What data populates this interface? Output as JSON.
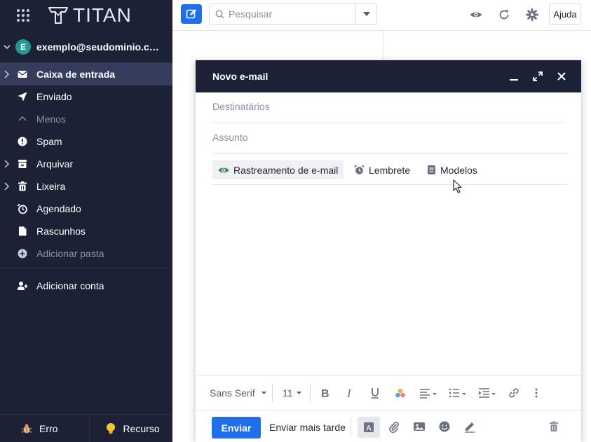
{
  "app": {
    "logo_text": "TITAN"
  },
  "account": {
    "avatar_letter": "E",
    "email": "exemplo@seudominio.co..."
  },
  "sidebar": {
    "items": [
      {
        "label": "Caixa de entrada",
        "icon": "inbox-icon",
        "active": true,
        "expandable": true
      },
      {
        "label": "Enviado",
        "icon": "send-icon",
        "active": false,
        "expandable": false
      },
      {
        "label": "Menos",
        "icon": "chevron-up-icon",
        "active": false,
        "expandable": false,
        "muted": true
      },
      {
        "label": "Spam",
        "icon": "spam-icon",
        "active": false,
        "expandable": false
      },
      {
        "label": "Arquivar",
        "icon": "archive-icon",
        "active": false,
        "expandable": true
      },
      {
        "label": "Lixeira",
        "icon": "trash-icon",
        "active": false,
        "expandable": true
      },
      {
        "label": "Agendado",
        "icon": "scheduled-clock-icon",
        "active": false,
        "expandable": false
      },
      {
        "label": "Rascunhos",
        "icon": "drafts-icon",
        "active": false,
        "expandable": false
      },
      {
        "label": "Adicionar pasta",
        "icon": "add-folder-icon",
        "active": false,
        "expandable": false,
        "muted": true
      }
    ],
    "add_account": "Adicionar conta",
    "footer": {
      "error_label": "Erro",
      "feature_label": "Recurso"
    }
  },
  "toolbar": {
    "search_placeholder": "Pesquisar",
    "help_label": "Ajuda"
  },
  "compose": {
    "title": "Novo e-mail",
    "recipients_placeholder": "Destinatários",
    "subject_placeholder": "Assunto",
    "options": {
      "tracking": "Rastreamento de e-mail",
      "reminder": "Lembrete",
      "templates": "Modelos"
    },
    "format": {
      "font": "Sans Serif",
      "size": "11"
    },
    "send_label": "Enviar",
    "send_later_label": "Enviar mais tarde"
  },
  "colors": {
    "sidebar_bg": "#1c2135",
    "active_item_bg": "#363d5c",
    "accent_blue": "#1f6feb",
    "avatar_teal": "#1f9a94",
    "tracking_green": "#3d8b5a"
  }
}
